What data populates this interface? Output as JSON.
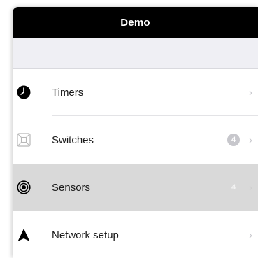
{
  "app": {
    "title": "Demo"
  },
  "menu": {
    "items": [
      {
        "label": "Timers",
        "icon": "clock-icon",
        "badge": "",
        "selected": false
      },
      {
        "label": "Switches",
        "icon": "switch-icon",
        "badge": "4",
        "selected": false
      },
      {
        "label": "Sensors",
        "icon": "sensor-icon",
        "badge": "4",
        "selected": true
      },
      {
        "label": "Network setup",
        "icon": "network-icon",
        "badge": "",
        "selected": false
      }
    ]
  },
  "colors": {
    "titlebar": "#000000",
    "selected_row": "#d9d9d9",
    "chevron": "#c7c7cc",
    "badge": "#c7c7cc"
  }
}
